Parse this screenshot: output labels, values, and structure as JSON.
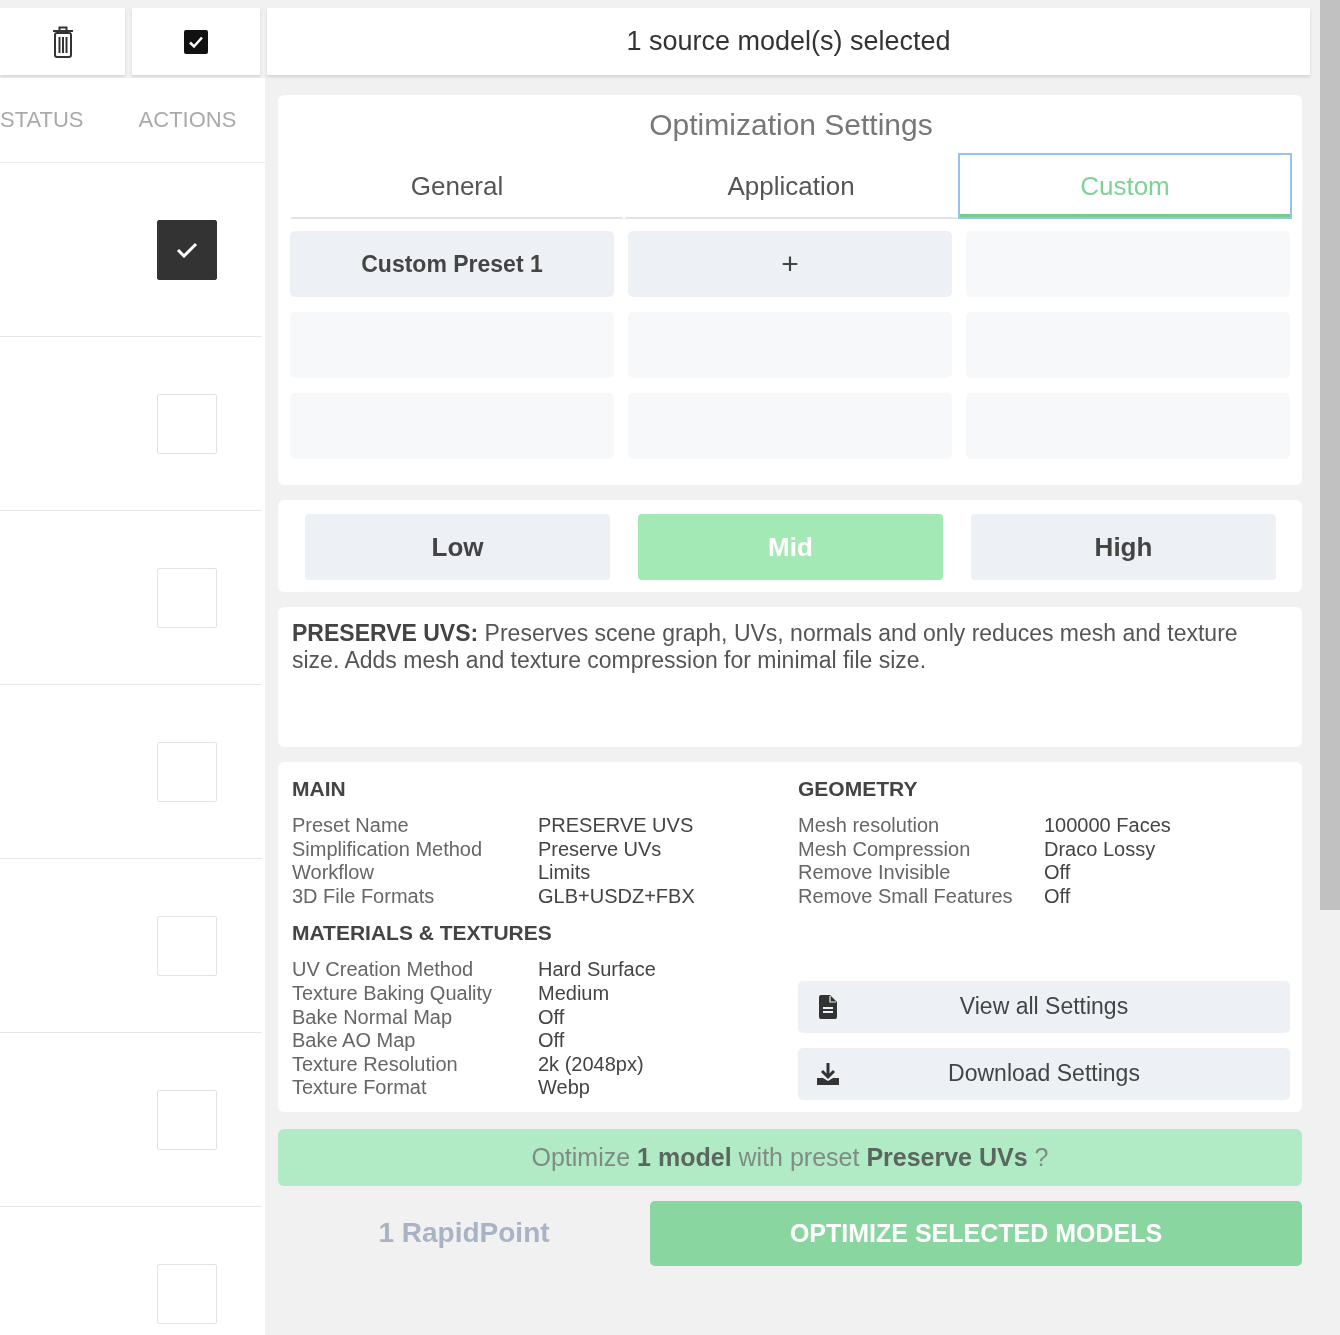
{
  "toolbar": {
    "select_all_checked": true
  },
  "selection_summary": "1 source model(s) selected",
  "table": {
    "columns": [
      "STATUS",
      "ACTIONS"
    ],
    "rows": [
      {
        "checked": true
      },
      {
        "checked": false
      },
      {
        "checked": false
      },
      {
        "checked": false
      },
      {
        "checked": false
      },
      {
        "checked": false
      },
      {
        "checked": false
      }
    ]
  },
  "optimization_settings": {
    "title": "Optimization Settings",
    "tabs": [
      {
        "label": "General",
        "selected": false
      },
      {
        "label": "Application",
        "selected": false
      },
      {
        "label": "Custom",
        "selected": true
      }
    ],
    "presets": [
      {
        "kind": "preset",
        "label": "Custom Preset 1"
      },
      {
        "kind": "add",
        "label": "+"
      },
      {
        "kind": "empty"
      },
      {
        "kind": "empty"
      },
      {
        "kind": "empty"
      },
      {
        "kind": "empty"
      },
      {
        "kind": "empty"
      },
      {
        "kind": "empty"
      },
      {
        "kind": "empty"
      }
    ]
  },
  "quality_levels": [
    {
      "label": "Low",
      "selected": false
    },
    {
      "label": "Mid",
      "selected": true
    },
    {
      "label": "High",
      "selected": false
    }
  ],
  "description": "**PRESERVE UVS:** Preserves scene graph, UVs, normals and only reduces mesh and texture size. Adds mesh and texture compression for minimal file size.",
  "summary": {
    "columns": [
      {
        "sections": [
          {
            "title": "MAIN",
            "rows": [
              {
                "label": "Preset Name",
                "value": "PRESERVE UVS"
              },
              {
                "label": "Simplification Method",
                "value": "Preserve UVs"
              },
              {
                "label": "Workflow",
                "value": "Limits"
              },
              {
                "label": "3D File Formats",
                "value": "GLB+USDZ+FBX"
              }
            ]
          },
          {
            "title": "MATERIALS & TEXTURES",
            "rows": [
              {
                "label": "UV Creation Method",
                "value": "Hard Surface"
              },
              {
                "label": "Texture Baking Quality",
                "value": "Medium"
              },
              {
                "label": "Bake Normal Map",
                "value": "Off"
              },
              {
                "label": "Bake AO Map",
                "value": "Off"
              },
              {
                "label": "Texture Resolution",
                "value": "2k (2048px)"
              },
              {
                "label": "Texture Format",
                "value": "Webp"
              }
            ]
          }
        ]
      },
      {
        "sections": [
          {
            "title": "GEOMETRY",
            "rows": [
              {
                "label": "Mesh resolution",
                "value": "100000 Faces"
              },
              {
                "label": "Mesh Compression",
                "value": "Draco Lossy"
              },
              {
                "label": "Remove Invisible",
                "value": "Off"
              },
              {
                "label": "Remove Small Features",
                "value": "Off"
              }
            ]
          }
        ],
        "buttons": [
          {
            "kind": "view",
            "label": "View all Settings"
          },
          {
            "kind": "download",
            "label": "Download Settings"
          }
        ]
      }
    ]
  },
  "confirmation": "Optimize **1 model** with preset **Preserve UVs** ?",
  "footer": {
    "credits": "1 RapidPoint",
    "button": "OPTIMIZE SELECTED MODELS"
  }
}
